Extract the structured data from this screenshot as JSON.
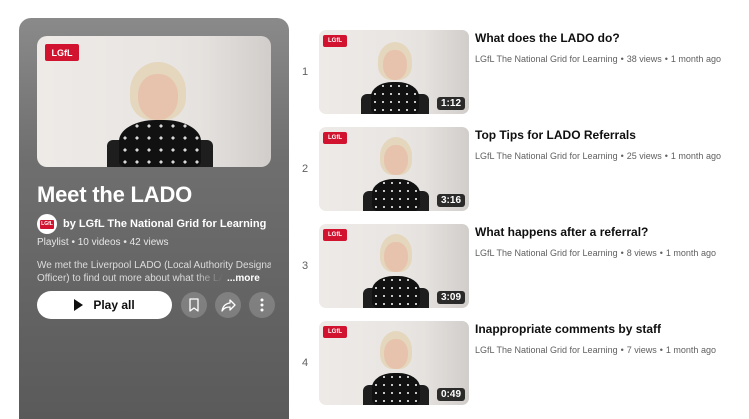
{
  "playlist": {
    "thumb_logo": "LGfL",
    "title": "Meet the LADO",
    "owner": "by LGfL The National Grid for Learning",
    "owner_avatar_logo": "LGfL",
    "meta": "Playlist • 10 videos • 42 views",
    "description_line1": "We met the Liverpool LADO (Local Authority Designated",
    "description_line2": "Officer) to find out more about what the LADO does",
    "more_label": "...more",
    "play_all_label": "Play all",
    "icons": {
      "play": "play-icon",
      "save": "bookmark-icon",
      "share": "share-icon",
      "more": "more-vert-icon"
    }
  },
  "videos": [
    {
      "index": "1",
      "title": "What does the LADO do?",
      "channel": "LGfL The National Grid for Learning",
      "views": "38 views",
      "age": "1 month ago",
      "duration": "1:12",
      "logo": "LGfL"
    },
    {
      "index": "2",
      "title": "Top Tips for LADO Referrals",
      "channel": "LGfL The National Grid for Learning",
      "views": "25 views",
      "age": "1 month ago",
      "duration": "3:16",
      "logo": "LGfL"
    },
    {
      "index": "3",
      "title": "What happens after a referral?",
      "channel": "LGfL The National Grid for Learning",
      "views": "8 views",
      "age": "1 month ago",
      "duration": "3:09",
      "logo": "LGfL"
    },
    {
      "index": "4",
      "title": "Inappropriate comments by staff",
      "channel": "LGfL The National Grid for Learning",
      "views": "7 views",
      "age": "1 month ago",
      "duration": "0:49",
      "logo": "LGfL"
    }
  ],
  "colors": {
    "brand_red": "#d2132f",
    "panel_gray": "#6f6f6f",
    "meta_gray": "#606060"
  }
}
